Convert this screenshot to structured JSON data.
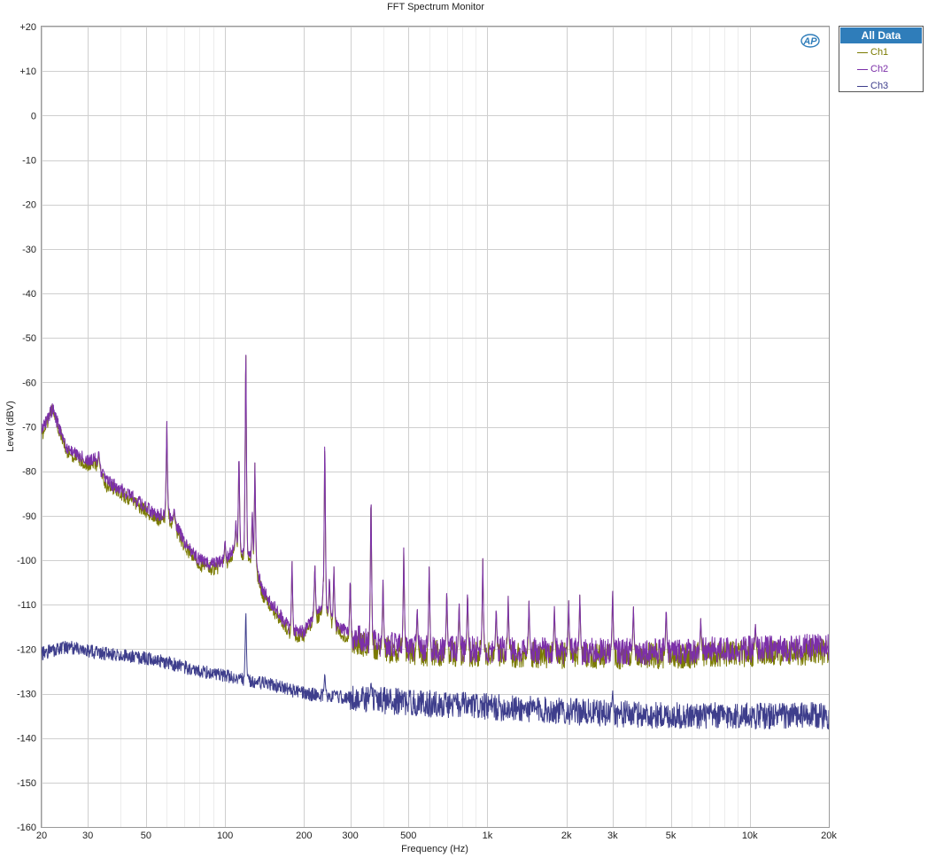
{
  "window": {
    "title": "FFT Spectrum Monitor"
  },
  "logo": {
    "text": "AP"
  },
  "legend": {
    "header": "All Data",
    "items": [
      {
        "label": "Ch1",
        "color": "#7a7a00"
      },
      {
        "label": "Ch2",
        "color": "#7b2fa8"
      },
      {
        "label": "Ch3",
        "color": "#3e3e8c"
      }
    ]
  },
  "chart_data": {
    "type": "line",
    "title": "FFT Spectrum Monitor",
    "xlabel": "Frequency (Hz)",
    "ylabel": "Level (dBV)",
    "xscale": "log",
    "xlim": [
      20,
      20000
    ],
    "ylim": [
      -160,
      20
    ],
    "grid": true,
    "legend_position": "right-top",
    "x_ticks": [
      {
        "value": 20,
        "label": "20"
      },
      {
        "value": 30,
        "label": "30"
      },
      {
        "value": 50,
        "label": "50"
      },
      {
        "value": 100,
        "label": "100"
      },
      {
        "value": 200,
        "label": "200"
      },
      {
        "value": 300,
        "label": "300"
      },
      {
        "value": 500,
        "label": "500"
      },
      {
        "value": 1000,
        "label": "1k"
      },
      {
        "value": 2000,
        "label": "2k"
      },
      {
        "value": 3000,
        "label": "3k"
      },
      {
        "value": 5000,
        "label": "5k"
      },
      {
        "value": 10000,
        "label": "10k"
      },
      {
        "value": 20000,
        "label": "20k"
      }
    ],
    "y_ticks": [
      {
        "value": 20,
        "label": "+20"
      },
      {
        "value": 10,
        "label": "+10"
      },
      {
        "value": 0,
        "label": "0"
      },
      {
        "value": -10,
        "label": "-10"
      },
      {
        "value": -20,
        "label": "-20"
      },
      {
        "value": -30,
        "label": "-30"
      },
      {
        "value": -40,
        "label": "-40"
      },
      {
        "value": -50,
        "label": "-50"
      },
      {
        "value": -60,
        "label": "-60"
      },
      {
        "value": -70,
        "label": "-70"
      },
      {
        "value": -80,
        "label": "-80"
      },
      {
        "value": -90,
        "label": "-90"
      },
      {
        "value": -100,
        "label": "-100"
      },
      {
        "value": -110,
        "label": "-110"
      },
      {
        "value": -120,
        "label": "-120"
      },
      {
        "value": -130,
        "label": "-130"
      },
      {
        "value": -140,
        "label": "-140"
      },
      {
        "value": -150,
        "label": "-150"
      },
      {
        "value": -160,
        "label": "-160"
      }
    ],
    "series": [
      {
        "name": "Ch1",
        "color": "#7a7a00",
        "noise_ripple_db": 3,
        "floor": [
          [
            20,
            -72
          ],
          [
            22,
            -66
          ],
          [
            25,
            -76
          ],
          [
            30,
            -78.5
          ],
          [
            32,
            -78
          ],
          [
            35,
            -83
          ],
          [
            40,
            -85
          ],
          [
            50,
            -89
          ],
          [
            55,
            -91
          ],
          [
            60,
            -90
          ],
          [
            65,
            -93
          ],
          [
            70,
            -97
          ],
          [
            80,
            -101
          ],
          [
            90,
            -102
          ],
          [
            100,
            -101
          ],
          [
            110,
            -98
          ],
          [
            120,
            -99
          ],
          [
            130,
            -102
          ],
          [
            140,
            -108
          ],
          [
            160,
            -113
          ],
          [
            180,
            -117
          ],
          [
            200,
            -117
          ],
          [
            220,
            -113
          ],
          [
            240,
            -112
          ],
          [
            260,
            -115
          ],
          [
            300,
            -118
          ],
          [
            400,
            -120
          ],
          [
            600,
            -121
          ],
          [
            1000,
            -121
          ],
          [
            2000,
            -121.5
          ],
          [
            5000,
            -121.5
          ],
          [
            10000,
            -121
          ],
          [
            20000,
            -120.5
          ]
        ],
        "peaks": [
          [
            33,
            -75
          ],
          [
            60,
            -68
          ],
          [
            64,
            -88
          ],
          [
            100,
            -95
          ],
          [
            110,
            -91
          ],
          [
            113,
            -74
          ],
          [
            120,
            -48
          ],
          [
            127,
            -88
          ],
          [
            130,
            -77
          ],
          [
            180,
            -99
          ],
          [
            220,
            -100
          ],
          [
            237,
            -104
          ],
          [
            240,
            -70
          ],
          [
            250,
            -103
          ],
          [
            260,
            -101
          ],
          [
            300,
            -103
          ],
          [
            360,
            -82
          ],
          [
            400,
            -104
          ],
          [
            480,
            -96
          ],
          [
            540,
            -110
          ],
          [
            600,
            -100
          ],
          [
            700,
            -106
          ],
          [
            780,
            -109
          ],
          [
            840,
            -106
          ],
          [
            960,
            -99
          ],
          [
            1080,
            -110
          ],
          [
            1200,
            -108
          ],
          [
            1440,
            -109
          ],
          [
            1800,
            -110
          ],
          [
            2040,
            -109
          ],
          [
            2250,
            -107
          ],
          [
            3000,
            -106
          ],
          [
            3600,
            -110
          ],
          [
            4800,
            -110
          ],
          [
            6500,
            -113
          ],
          [
            10500,
            -114
          ]
        ]
      },
      {
        "name": "Ch2",
        "color": "#7b2fa8",
        "noise_ripple_db": 3,
        "floor": [
          [
            20,
            -71
          ],
          [
            22,
            -66
          ],
          [
            25,
            -75
          ],
          [
            30,
            -77.5
          ],
          [
            32,
            -77
          ],
          [
            35,
            -82
          ],
          [
            40,
            -84
          ],
          [
            50,
            -88
          ],
          [
            55,
            -90
          ],
          [
            60,
            -89
          ],
          [
            65,
            -92
          ],
          [
            70,
            -96
          ],
          [
            80,
            -100
          ],
          [
            90,
            -101
          ],
          [
            100,
            -100
          ],
          [
            110,
            -97
          ],
          [
            120,
            -98
          ],
          [
            130,
            -101
          ],
          [
            140,
            -107
          ],
          [
            160,
            -112
          ],
          [
            180,
            -116
          ],
          [
            200,
            -116
          ],
          [
            220,
            -112
          ],
          [
            240,
            -111
          ],
          [
            260,
            -114
          ],
          [
            300,
            -117
          ],
          [
            400,
            -119
          ],
          [
            600,
            -120
          ],
          [
            1000,
            -120
          ],
          [
            2000,
            -120.5
          ],
          [
            5000,
            -120.5
          ],
          [
            10000,
            -120
          ],
          [
            20000,
            -119.5
          ]
        ],
        "peaks": [
          [
            33,
            -75
          ],
          [
            60,
            -68
          ],
          [
            64,
            -88
          ],
          [
            100,
            -95
          ],
          [
            110,
            -91
          ],
          [
            113,
            -74
          ],
          [
            120,
            -48
          ],
          [
            127,
            -88
          ],
          [
            130,
            -77
          ],
          [
            180,
            -99
          ],
          [
            220,
            -100
          ],
          [
            237,
            -104
          ],
          [
            240,
            -69
          ],
          [
            250,
            -103
          ],
          [
            260,
            -101
          ],
          [
            300,
            -103
          ],
          [
            360,
            -82
          ],
          [
            400,
            -104
          ],
          [
            480,
            -96
          ],
          [
            540,
            -110
          ],
          [
            600,
            -100
          ],
          [
            700,
            -106
          ],
          [
            780,
            -109
          ],
          [
            840,
            -106
          ],
          [
            960,
            -99
          ],
          [
            1080,
            -110
          ],
          [
            1200,
            -108
          ],
          [
            1440,
            -109
          ],
          [
            1800,
            -110
          ],
          [
            2040,
            -109
          ],
          [
            2250,
            -107
          ],
          [
            3000,
            -106
          ],
          [
            3600,
            -110
          ],
          [
            4800,
            -110
          ],
          [
            6500,
            -113
          ],
          [
            10500,
            -114
          ]
        ]
      },
      {
        "name": "Ch3",
        "color": "#3e3e8c",
        "noise_ripple_db": 3,
        "floor": [
          [
            20,
            -121
          ],
          [
            25,
            -119.5
          ],
          [
            30,
            -120.5
          ],
          [
            35,
            -121
          ],
          [
            40,
            -121.5
          ],
          [
            50,
            -122
          ],
          [
            60,
            -123
          ],
          [
            70,
            -124
          ],
          [
            80,
            -125
          ],
          [
            100,
            -126
          ],
          [
            120,
            -127
          ],
          [
            150,
            -128
          ],
          [
            200,
            -130
          ],
          [
            300,
            -131
          ],
          [
            500,
            -132
          ],
          [
            1000,
            -133
          ],
          [
            2000,
            -134
          ],
          [
            3000,
            -134.5
          ],
          [
            5000,
            -135
          ],
          [
            10000,
            -135
          ],
          [
            20000,
            -135
          ]
        ],
        "peaks": [
          [
            120,
            -110
          ],
          [
            240,
            -125
          ],
          [
            360,
            -127
          ],
          [
            3000,
            -129
          ]
        ]
      }
    ]
  }
}
